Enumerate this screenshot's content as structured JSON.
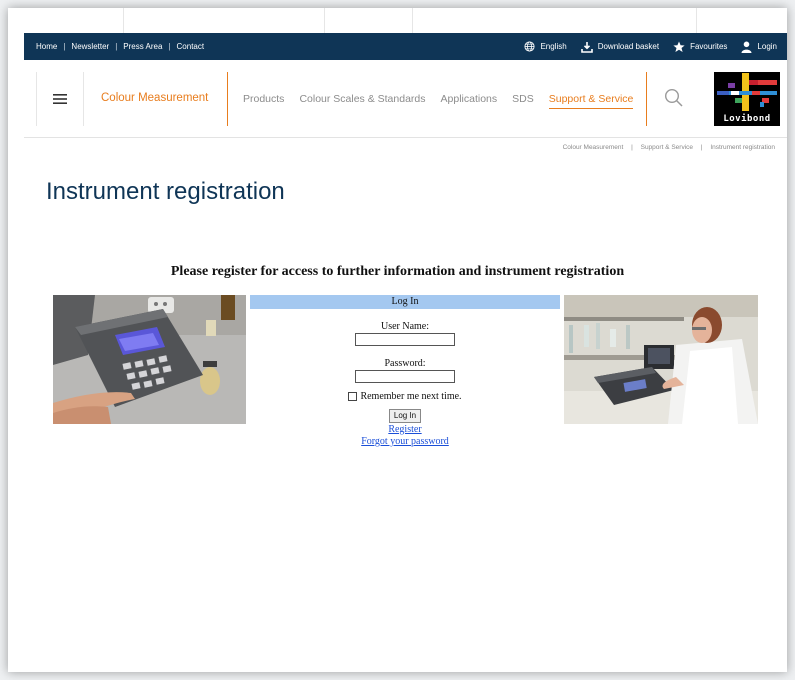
{
  "utility_bar": {
    "links": [
      "Home",
      "Newsletter",
      "Press Area",
      "Contact"
    ],
    "language": "English",
    "download_basket": "Download basket",
    "favourites": "Favourites",
    "login": "Login"
  },
  "header": {
    "brand_title": "Colour Measurement",
    "nav": [
      "Products",
      "Colour Scales & Standards",
      "Applications",
      "SDS",
      "Support & Service"
    ],
    "active_nav": "Support & Service",
    "logo_text": "Lovibond"
  },
  "breadcrumb": [
    "Colour Measurement",
    "Support & Service",
    "Instrument registration"
  ],
  "page_title": "Instrument registration",
  "register_title": "Please register for access to further information and instrument registration",
  "login_form": {
    "heading": "Log In",
    "username_label": "User Name:",
    "username_value": "",
    "password_label": "Password:",
    "password_value": "",
    "remember_label": "Remember me next time.",
    "remember_checked": false,
    "submit_label": "Log In",
    "register_link": "Register",
    "forgot_link": "Forgot your password"
  },
  "colors": {
    "navy": "#0f3556",
    "orange": "#e87d1e",
    "login_header": "#a4c8f0",
    "link": "#1a4ed8"
  }
}
